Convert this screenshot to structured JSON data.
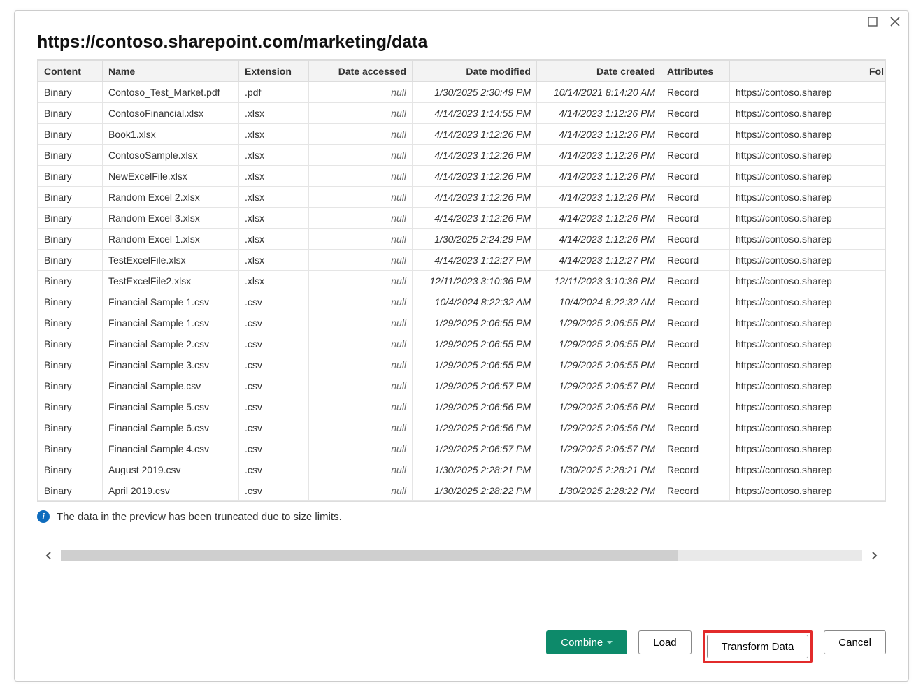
{
  "header": {
    "title": "https://contoso.sharepoint.com/marketing/data"
  },
  "table": {
    "columns": [
      "Content",
      "Name",
      "Extension",
      "Date accessed",
      "Date modified",
      "Date created",
      "Attributes",
      "Folder"
    ],
    "folder_truncated": "https://contoso.sharep",
    "rows": [
      {
        "content": "Binary",
        "name": "Contoso_Test_Market.pdf",
        "ext": ".pdf",
        "accessed": "null",
        "modified": "1/30/2025 2:30:49 PM",
        "created": "10/14/2021 8:14:20 AM",
        "attr": "Record"
      },
      {
        "content": "Binary",
        "name": "ContosoFinancial.xlsx",
        "ext": ".xlsx",
        "accessed": "null",
        "modified": "4/14/2023 1:14:55 PM",
        "created": "4/14/2023 1:12:26 PM",
        "attr": "Record"
      },
      {
        "content": "Binary",
        "name": "Book1.xlsx",
        "ext": ".xlsx",
        "accessed": "null",
        "modified": "4/14/2023 1:12:26 PM",
        "created": "4/14/2023 1:12:26 PM",
        "attr": "Record"
      },
      {
        "content": "Binary",
        "name": "ContosoSample.xlsx",
        "ext": ".xlsx",
        "accessed": "null",
        "modified": "4/14/2023 1:12:26 PM",
        "created": "4/14/2023 1:12:26 PM",
        "attr": "Record"
      },
      {
        "content": "Binary",
        "name": "NewExcelFile.xlsx",
        "ext": ".xlsx",
        "accessed": "null",
        "modified": "4/14/2023 1:12:26 PM",
        "created": "4/14/2023 1:12:26 PM",
        "attr": "Record"
      },
      {
        "content": "Binary",
        "name": "Random Excel 2.xlsx",
        "ext": ".xlsx",
        "accessed": "null",
        "modified": "4/14/2023 1:12:26 PM",
        "created": "4/14/2023 1:12:26 PM",
        "attr": "Record"
      },
      {
        "content": "Binary",
        "name": "Random Excel 3.xlsx",
        "ext": ".xlsx",
        "accessed": "null",
        "modified": "4/14/2023 1:12:26 PM",
        "created": "4/14/2023 1:12:26 PM",
        "attr": "Record"
      },
      {
        "content": "Binary",
        "name": "Random Excel 1.xlsx",
        "ext": ".xlsx",
        "accessed": "null",
        "modified": "1/30/2025 2:24:29 PM",
        "created": "4/14/2023 1:12:26 PM",
        "attr": "Record"
      },
      {
        "content": "Binary",
        "name": "TestExcelFile.xlsx",
        "ext": ".xlsx",
        "accessed": "null",
        "modified": "4/14/2023 1:12:27 PM",
        "created": "4/14/2023 1:12:27 PM",
        "attr": "Record"
      },
      {
        "content": "Binary",
        "name": "TestExcelFile2.xlsx",
        "ext": ".xlsx",
        "accessed": "null",
        "modified": "12/11/2023 3:10:36 PM",
        "created": "12/11/2023 3:10:36 PM",
        "attr": "Record"
      },
      {
        "content": "Binary",
        "name": "Financial Sample 1.csv",
        "ext": ".csv",
        "accessed": "null",
        "modified": "10/4/2024 8:22:32 AM",
        "created": "10/4/2024 8:22:32 AM",
        "attr": "Record"
      },
      {
        "content": "Binary",
        "name": "Financial Sample 1.csv",
        "ext": ".csv",
        "accessed": "null",
        "modified": "1/29/2025 2:06:55 PM",
        "created": "1/29/2025 2:06:55 PM",
        "attr": "Record"
      },
      {
        "content": "Binary",
        "name": "Financial Sample 2.csv",
        "ext": ".csv",
        "accessed": "null",
        "modified": "1/29/2025 2:06:55 PM",
        "created": "1/29/2025 2:06:55 PM",
        "attr": "Record"
      },
      {
        "content": "Binary",
        "name": "Financial Sample 3.csv",
        "ext": ".csv",
        "accessed": "null",
        "modified": "1/29/2025 2:06:55 PM",
        "created": "1/29/2025 2:06:55 PM",
        "attr": "Record"
      },
      {
        "content": "Binary",
        "name": "Financial Sample.csv",
        "ext": ".csv",
        "accessed": "null",
        "modified": "1/29/2025 2:06:57 PM",
        "created": "1/29/2025 2:06:57 PM",
        "attr": "Record"
      },
      {
        "content": "Binary",
        "name": "Financial Sample 5.csv",
        "ext": ".csv",
        "accessed": "null",
        "modified": "1/29/2025 2:06:56 PM",
        "created": "1/29/2025 2:06:56 PM",
        "attr": "Record"
      },
      {
        "content": "Binary",
        "name": "Financial Sample 6.csv",
        "ext": ".csv",
        "accessed": "null",
        "modified": "1/29/2025 2:06:56 PM",
        "created": "1/29/2025 2:06:56 PM",
        "attr": "Record"
      },
      {
        "content": "Binary",
        "name": "Financial Sample 4.csv",
        "ext": ".csv",
        "accessed": "null",
        "modified": "1/29/2025 2:06:57 PM",
        "created": "1/29/2025 2:06:57 PM",
        "attr": "Record"
      },
      {
        "content": "Binary",
        "name": "August 2019.csv",
        "ext": ".csv",
        "accessed": "null",
        "modified": "1/30/2025 2:28:21 PM",
        "created": "1/30/2025 2:28:21 PM",
        "attr": "Record"
      },
      {
        "content": "Binary",
        "name": "April 2019.csv",
        "ext": ".csv",
        "accessed": "null",
        "modified": "1/30/2025 2:28:22 PM",
        "created": "1/30/2025 2:28:22 PM",
        "attr": "Record"
      }
    ]
  },
  "info": {
    "message": "The data in the preview has been truncated due to size limits."
  },
  "footer": {
    "combine": "Combine",
    "load": "Load",
    "transform": "Transform Data",
    "cancel": "Cancel"
  },
  "partial_last_col_header": "Fol"
}
